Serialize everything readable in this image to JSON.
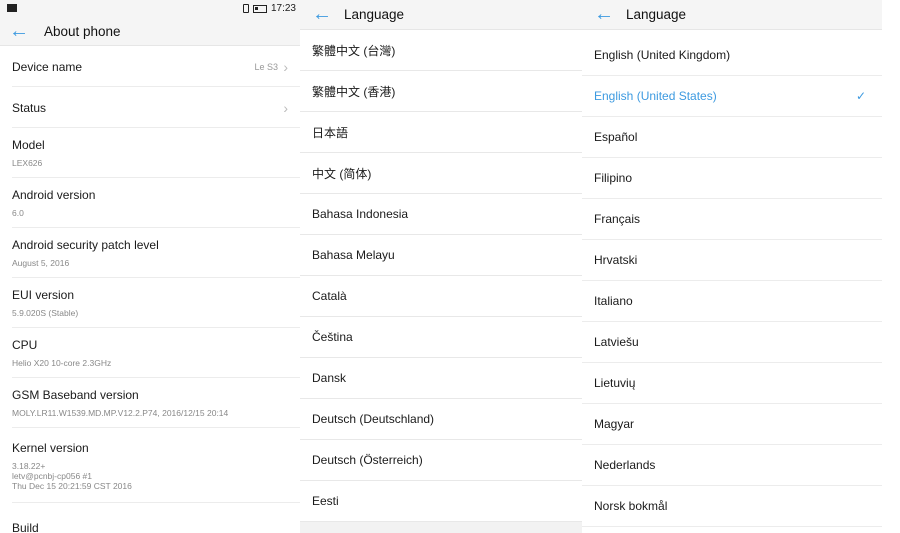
{
  "status_bar": {
    "time": "17:23"
  },
  "about": {
    "title": "About phone",
    "items": [
      {
        "label": "Device name",
        "value": "Le S3",
        "chevron": true
      },
      {
        "label": "Status",
        "chevron": true
      },
      {
        "label": "Model",
        "sub": "LEX626"
      },
      {
        "label": "Android version",
        "sub": "6.0"
      },
      {
        "label": "Android security patch level",
        "sub": "August 5, 2016"
      },
      {
        "label": "EUI version",
        "sub": "5.9.020S (Stable)"
      },
      {
        "label": "CPU",
        "sub": "Helio X20  10-core 2.3GHz"
      },
      {
        "label": "GSM Baseband version",
        "sub": "MOLY.LR11.W1539.MD.MP.V12.2.P74, 2016/12/15 20:14"
      },
      {
        "label": "Kernel version",
        "sub_lines": [
          "3.18.22+",
          "letv@pcnbj-cp056 #1",
          "Thu Dec 15 20:21:59 CST 2016"
        ]
      },
      {
        "label": "Build"
      }
    ]
  },
  "language1": {
    "title": "Language",
    "items": [
      "繁體中文 (台灣)",
      "繁體中文 (香港)",
      "日本語",
      "中文 (简体)",
      "Bahasa Indonesia",
      "Bahasa Melayu",
      "Català",
      "Čeština",
      "Dansk",
      "Deutsch (Deutschland)",
      "Deutsch (Österreich)",
      "Eesti"
    ]
  },
  "language2": {
    "title": "Language",
    "selected": "English (United States)",
    "items": [
      "English (United Kingdom)",
      "English (United States)",
      "Español",
      "Filipino",
      "Français",
      "Hrvatski",
      "Italiano",
      "Latviešu",
      "Lietuvių",
      "Magyar",
      "Nederlands",
      "Norsk bokmål"
    ]
  },
  "colors": {
    "accent": "#3d9ae0"
  }
}
